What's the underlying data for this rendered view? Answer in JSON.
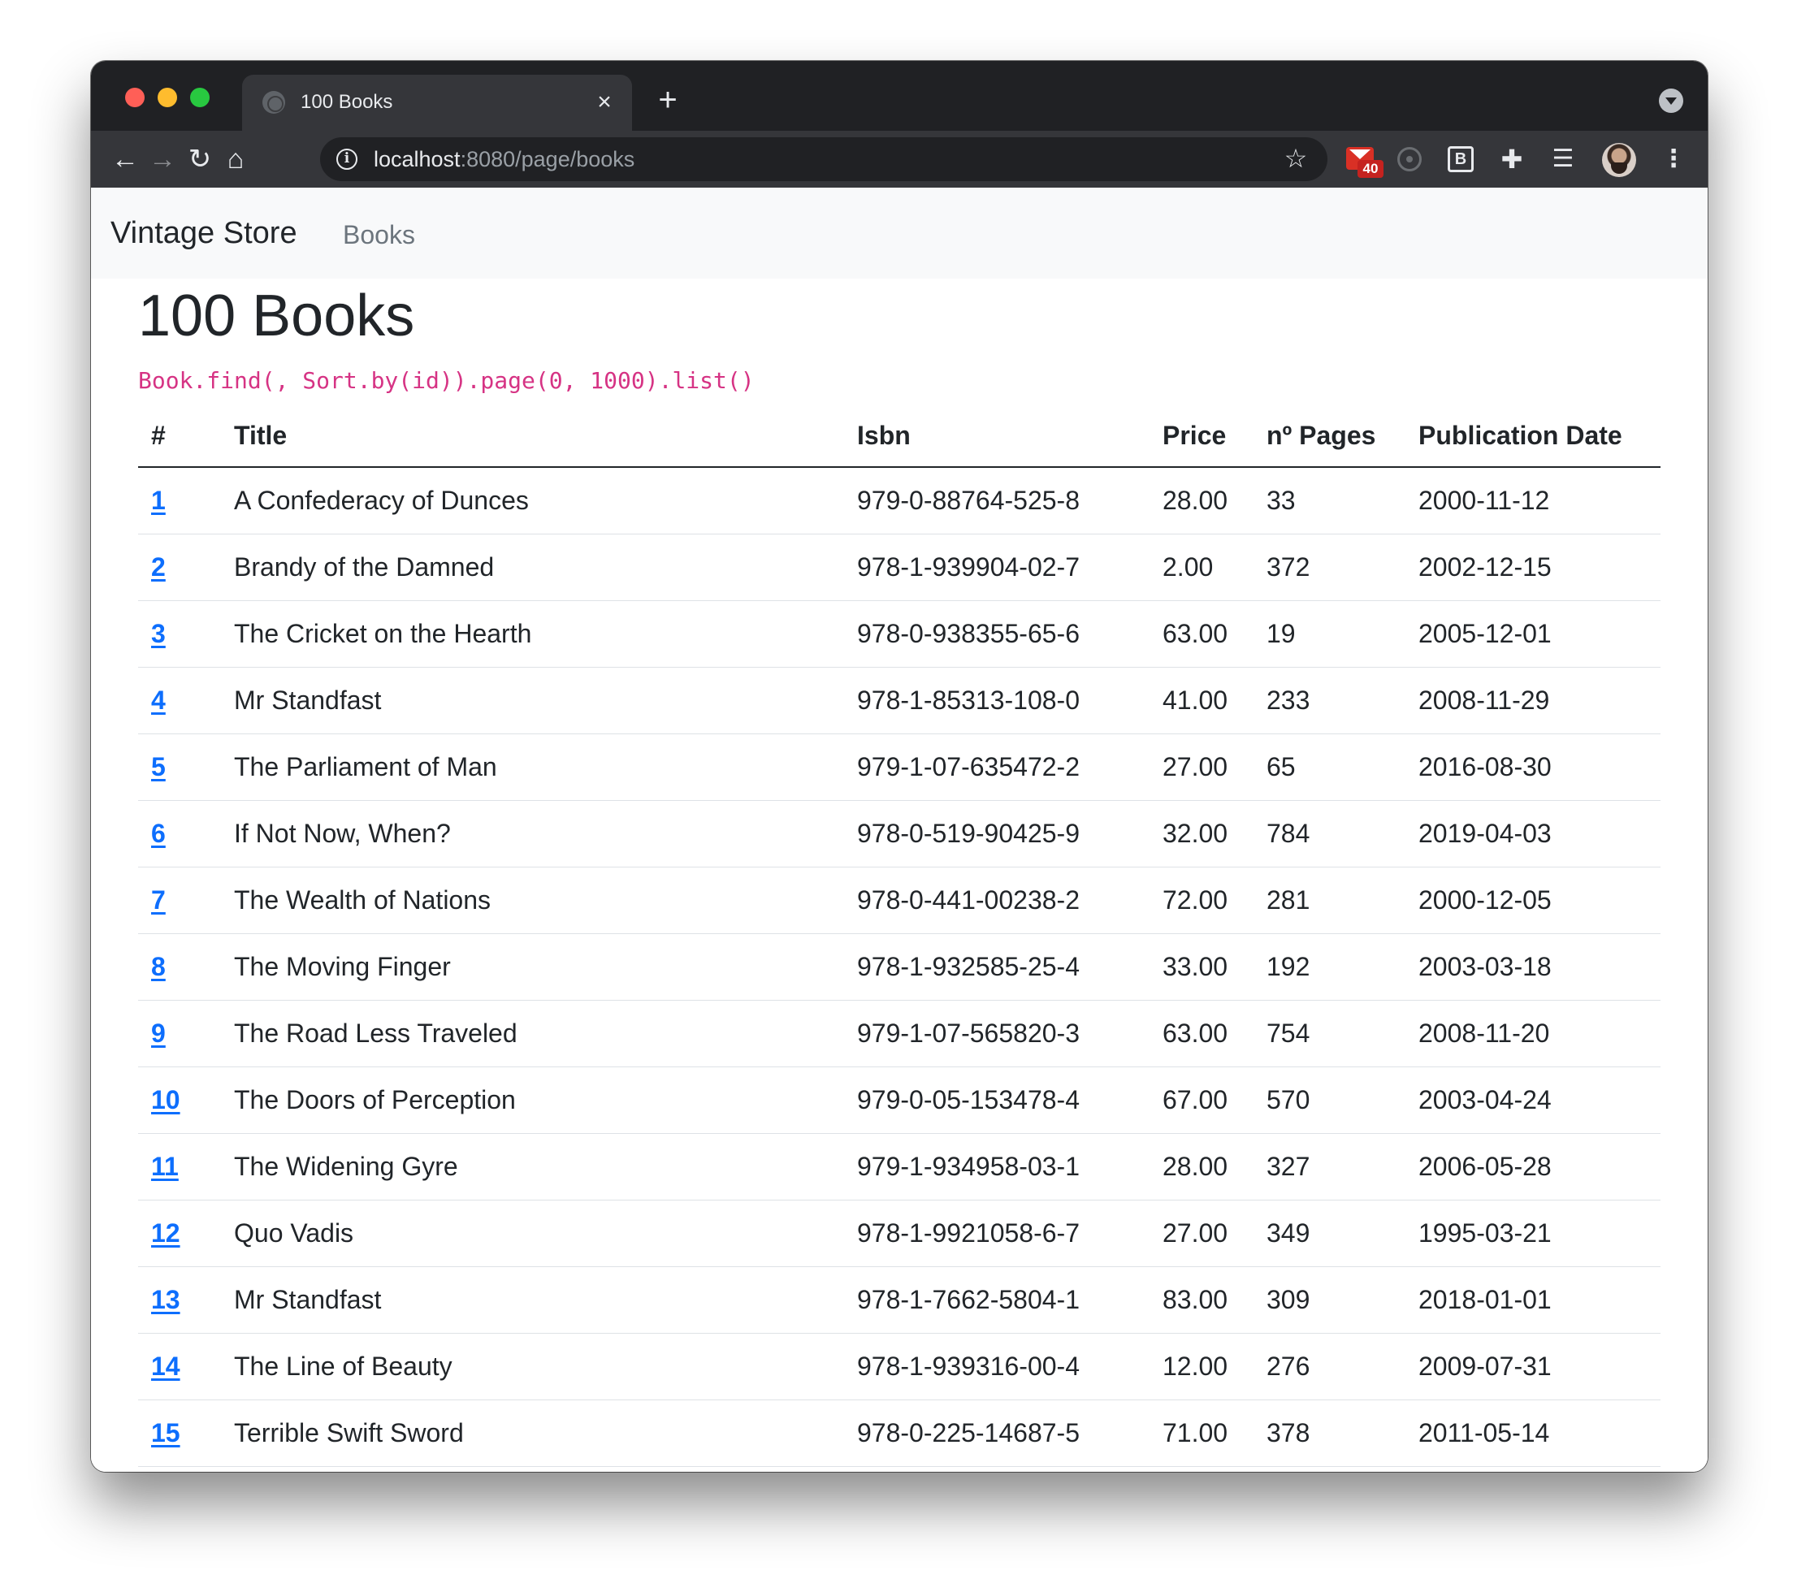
{
  "browser": {
    "tab_title": "100 Books",
    "tab_close": "×",
    "new_tab": "+",
    "url_host": "localhost",
    "url_rest": ":8080/page/books",
    "gmail_badge": "40",
    "ext_b_label": "B"
  },
  "navbar": {
    "brand": "Vintage Store",
    "link": "Books"
  },
  "main": {
    "title": "100 Books",
    "query": "Book.find(, Sort.by(id)).page(0, 1000).list()"
  },
  "table": {
    "headers": [
      "#",
      "Title",
      "Isbn",
      "Price",
      "nº Pages",
      "Publication Date"
    ],
    "rows": [
      {
        "id": "1",
        "title": "A Confederacy of Dunces",
        "isbn": "979-0-88764-525-8",
        "price": "28.00",
        "pages": "33",
        "date": "2000-11-12"
      },
      {
        "id": "2",
        "title": "Brandy of the Damned",
        "isbn": "978-1-939904-02-7",
        "price": "2.00",
        "pages": "372",
        "date": "2002-12-15"
      },
      {
        "id": "3",
        "title": "The Cricket on the Hearth",
        "isbn": "978-0-938355-65-6",
        "price": "63.00",
        "pages": "19",
        "date": "2005-12-01"
      },
      {
        "id": "4",
        "title": "Mr Standfast",
        "isbn": "978-1-85313-108-0",
        "price": "41.00",
        "pages": "233",
        "date": "2008-11-29"
      },
      {
        "id": "5",
        "title": "The Parliament of Man",
        "isbn": "979-1-07-635472-2",
        "price": "27.00",
        "pages": "65",
        "date": "2016-08-30"
      },
      {
        "id": "6",
        "title": "If Not Now, When?",
        "isbn": "978-0-519-90425-9",
        "price": "32.00",
        "pages": "784",
        "date": "2019-04-03"
      },
      {
        "id": "7",
        "title": "The Wealth of Nations",
        "isbn": "978-0-441-00238-2",
        "price": "72.00",
        "pages": "281",
        "date": "2000-12-05"
      },
      {
        "id": "8",
        "title": "The Moving Finger",
        "isbn": "978-1-932585-25-4",
        "price": "33.00",
        "pages": "192",
        "date": "2003-03-18"
      },
      {
        "id": "9",
        "title": "The Road Less Traveled",
        "isbn": "979-1-07-565820-3",
        "price": "63.00",
        "pages": "754",
        "date": "2008-11-20"
      },
      {
        "id": "10",
        "title": "The Doors of Perception",
        "isbn": "979-0-05-153478-4",
        "price": "67.00",
        "pages": "570",
        "date": "2003-04-24"
      },
      {
        "id": "11",
        "title": "The Widening Gyre",
        "isbn": "979-1-934958-03-1",
        "price": "28.00",
        "pages": "327",
        "date": "2006-05-28"
      },
      {
        "id": "12",
        "title": "Quo Vadis",
        "isbn": "978-1-9921058-6-7",
        "price": "27.00",
        "pages": "349",
        "date": "1995-03-21"
      },
      {
        "id": "13",
        "title": "Mr Standfast",
        "isbn": "978-1-7662-5804-1",
        "price": "83.00",
        "pages": "309",
        "date": "2018-01-01"
      },
      {
        "id": "14",
        "title": "The Line of Beauty",
        "isbn": "978-1-939316-00-4",
        "price": "12.00",
        "pages": "276",
        "date": "2009-07-31"
      },
      {
        "id": "15",
        "title": "Terrible Swift Sword",
        "isbn": "978-0-225-14687-5",
        "price": "71.00",
        "pages": "378",
        "date": "2011-05-14"
      }
    ]
  },
  "icons": {
    "back": "arrow-left-icon",
    "forward": "arrow-right-icon",
    "reload": "reload-icon",
    "home": "home-icon",
    "info": "info-icon",
    "bookmark": "star-icon",
    "extensions": "puzzle-icon",
    "media": "media-control-icon",
    "menu": "more-vertical-icon"
  },
  "colors": {
    "link": "#0d6efd",
    "code": "#d63384",
    "navbar_bg": "#f8f9fa",
    "chrome_dark": "#202124",
    "chrome_toolbar": "#35363a"
  }
}
